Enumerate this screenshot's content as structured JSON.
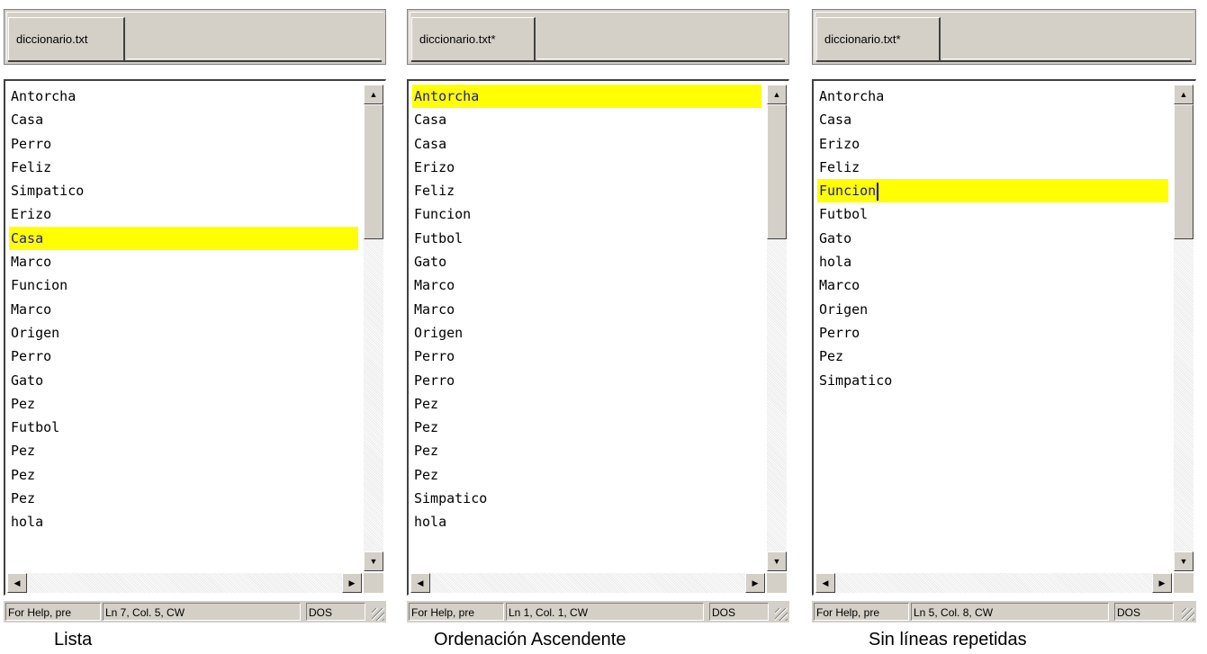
{
  "panels": [
    {
      "tab": "diccionario.txt",
      "lines": [
        "Antorcha",
        "Casa",
        "Perro",
        "Feliz",
        "Simpatico",
        "Erizo",
        "Casa",
        "Marco",
        "Funcion",
        "Marco",
        "Origen",
        "Perro",
        "Gato",
        "Pez",
        "Futbol",
        "Pez",
        "Pez",
        "Pez",
        "hola"
      ],
      "highlight_index": 6,
      "status": {
        "help": "For Help, pre",
        "position": "Ln 7, Col. 5, CW",
        "mode": "DOS"
      },
      "caption": "Lista"
    },
    {
      "tab": "diccionario.txt*",
      "lines": [
        "Antorcha",
        "Casa",
        "Casa",
        "Erizo",
        "Feliz",
        "Funcion",
        "Futbol",
        "Gato",
        "Marco",
        "Marco",
        "Origen",
        "Perro",
        "Perro",
        "Pez",
        "Pez",
        "Pez",
        "Pez",
        "Simpatico",
        "hola"
      ],
      "highlight_index": 0,
      "status": {
        "help": "For Help, pre",
        "position": "Ln 1, Col. 1, CW",
        "mode": "DOS"
      },
      "caption": "Ordenación Ascendente"
    },
    {
      "tab": "diccionario.txt*",
      "lines": [
        "Antorcha",
        "Casa",
        "Erizo",
        "Feliz",
        "Funcion",
        "Futbol",
        "Gato",
        "hola",
        "Marco",
        "Origen",
        "Perro",
        "Pez",
        "Simpatico"
      ],
      "highlight_index": 4,
      "status": {
        "help": "For Help, pre",
        "position": "Ln 5, Col. 8, CW",
        "mode": "DOS"
      },
      "caption": "Sin líneas repetidas"
    }
  ],
  "icons": {
    "up": "scroll-up-arrow-icon",
    "down": "scroll-down-arrow-icon",
    "left": "scroll-left-arrow-icon",
    "right": "scroll-right-arrow-icon"
  },
  "colors": {
    "highlight": "#ffff00",
    "highlight_text": "#1a1a99",
    "chrome": "#d4d0c8"
  }
}
